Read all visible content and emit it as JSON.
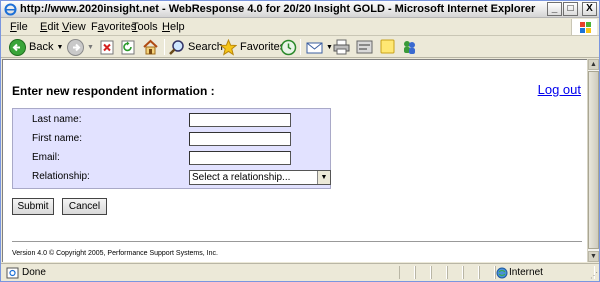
{
  "window": {
    "title": "http://www.2020insight.net - WebResponse 4.0 for 20/20 Insight GOLD - Microsoft Internet Explorer",
    "minimize": "_",
    "maximize": "□",
    "close": "X"
  },
  "menubar": {
    "items": [
      {
        "prefix": "",
        "accel": "F",
        "rest": "ile"
      },
      {
        "prefix": "",
        "accel": "E",
        "rest": "dit"
      },
      {
        "prefix": "",
        "accel": "V",
        "rest": "iew"
      },
      {
        "prefix": "F",
        "accel": "a",
        "rest": "vorites"
      },
      {
        "prefix": "",
        "accel": "T",
        "rest": "ools"
      },
      {
        "prefix": "",
        "accel": "H",
        "rest": "elp"
      }
    ]
  },
  "toolbar": {
    "back_label": "Back",
    "search_label": "Search",
    "favorites_label": "Favorites",
    "icons": [
      "back-icon",
      "forward-icon",
      "stop-icon",
      "refresh-icon",
      "home-icon",
      "search-icon",
      "favorites-icon",
      "history-icon",
      "mail-icon",
      "print-icon",
      "edit-icon",
      "discuss-icon",
      "messenger-icon"
    ]
  },
  "page": {
    "heading": "Enter new respondent information :",
    "logout": "Log out",
    "form": {
      "last_name_label": "Last name:",
      "first_name_label": "First name:",
      "email_label": "Email:",
      "relationship_label": "Relationship:",
      "last_name_value": "",
      "first_name_value": "",
      "email_value": "",
      "relationship_value": "Select a relationship..."
    },
    "submit": "Submit",
    "cancel": "Cancel",
    "footer": "Version 4.0 © Copyright 2005, Performance Support Systems, Inc."
  },
  "statusbar": {
    "status": "Done",
    "zone": "Internet"
  },
  "colors": {
    "form_panel_bg": "#e2e2ff",
    "link": "#0000ee"
  }
}
